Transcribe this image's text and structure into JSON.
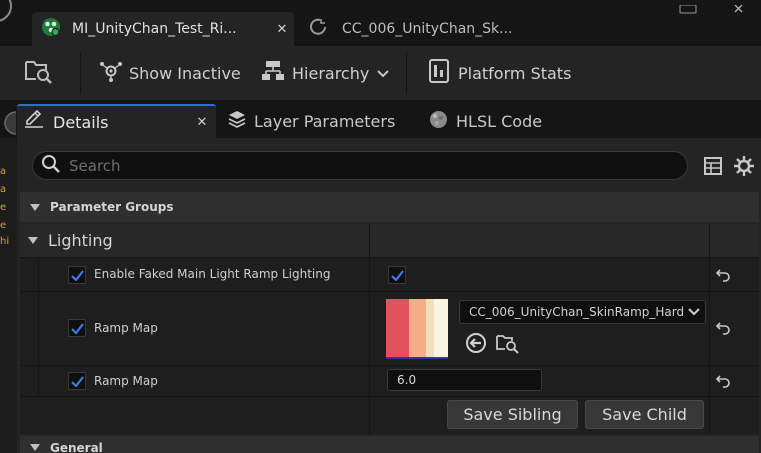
{
  "tabs": {
    "active_label": "MI_UnityChan_Test_Ri...",
    "active_close": "✕",
    "inactive_label": "CC_006_UnityChan_Sk..."
  },
  "toolbar": {
    "show_inactive_label": "Show Inactive",
    "hierarchy_label": "Hierarchy",
    "platform_stats_label": "Platform Stats"
  },
  "panel_tabs": {
    "details_label": "Details",
    "details_close": "✕",
    "layer_parameters_label": "Layer Parameters",
    "hlsl_code_label": "HLSL Code"
  },
  "search": {
    "placeholder": "Search"
  },
  "groups": {
    "parameter_groups": "Parameter Groups",
    "lighting": "Lighting",
    "general": "General"
  },
  "properties": {
    "faked_light_label": "Enable Faked Main Light  Ramp Lighting",
    "ramp_map_texture_label": "Ramp Map",
    "ramp_map_texture_value": "CC_006_UnityChan_SkinRamp_Hard",
    "ramp_map_scalar_label": "Ramp Map",
    "ramp_map_scalar_value": "6.0"
  },
  "buttons": {
    "save_sibling": "Save Sibling",
    "save_child": "Save Child"
  },
  "colors": {
    "accent": "#2f6bd8",
    "check": "#3d7de0",
    "ramp_band1": "#e2525c",
    "ramp_band2": "#f4ad87",
    "ramp_band3": "#f3e0b8",
    "ramp_band4": "#fbf5e0"
  }
}
